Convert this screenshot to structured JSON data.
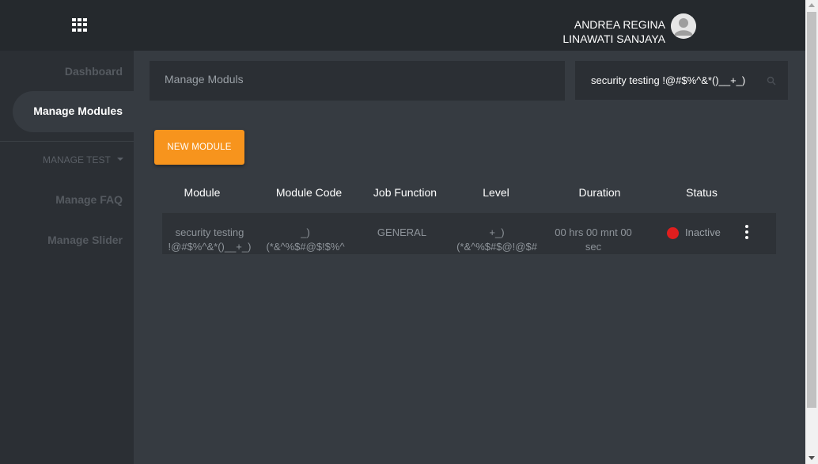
{
  "header": {
    "user_name_line1": "ANDREA REGINA",
    "user_name_line2": "LINAWATI SANJAYA",
    "menu_icon": "grid-icon",
    "avatar_icon": "user-avatar"
  },
  "sidebar": {
    "items": [
      {
        "label": "Dashboard"
      },
      {
        "label": "Manage Modules",
        "active": true
      },
      {
        "label": "MANAGE TEST"
      },
      {
        "label": "Manage FAQ"
      },
      {
        "label": "Manage Slider"
      }
    ]
  },
  "main": {
    "page_title": "Manage Moduls",
    "search": {
      "value": "security testing !@#$%^&*()__+_)",
      "placeholder": ""
    },
    "new_button_label": "NEW MODULE",
    "table": {
      "headers": [
        "Module",
        "Module Code",
        "Job Function",
        "Level",
        "Duration",
        "Status"
      ],
      "rows": [
        {
          "module_line1": "security testing",
          "module_line2": "!@#$%^&*()__+_)",
          "code_line1": "_)",
          "code_line2": "(*&^%$#@$!$%^",
          "job_function": "GENERAL",
          "level_line1": "+_)",
          "level_line2": "(*&^%$#$@!@$#",
          "duration_line1": "00 hrs 00 mnt 00",
          "duration_line2": "sec",
          "status": "Inactive",
          "status_color": "#e01e1e"
        }
      ]
    }
  },
  "colors": {
    "accent": "#f7941d",
    "topbar": "#25292d",
    "sidebar": "#2b2f34",
    "content": "#363b41"
  }
}
